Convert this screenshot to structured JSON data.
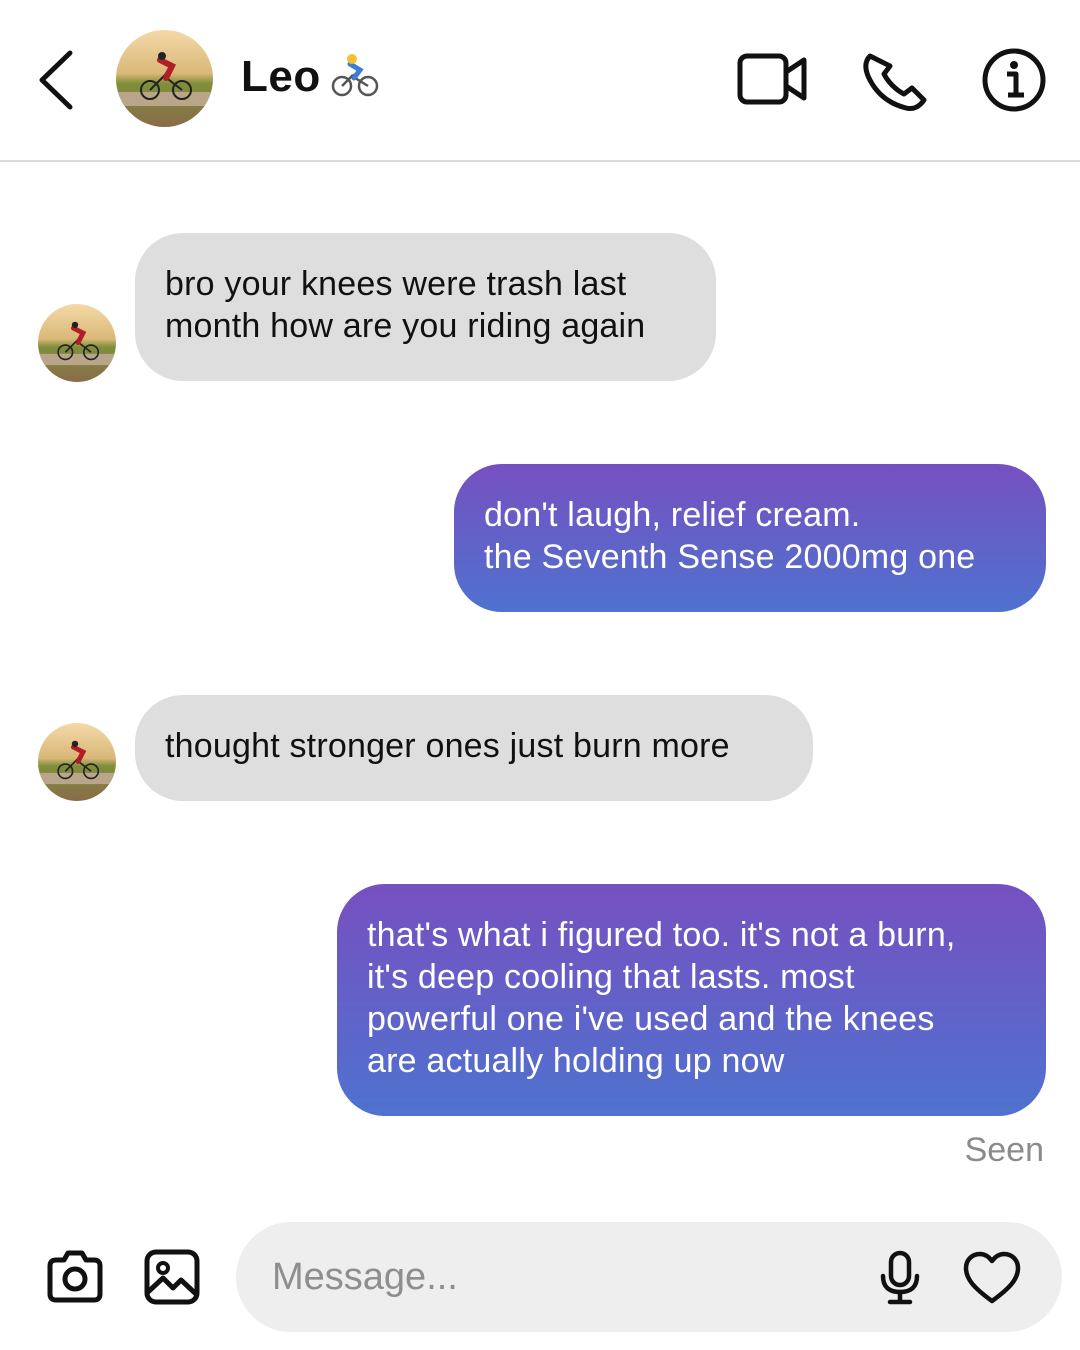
{
  "header": {
    "contact_name": "Leo",
    "icons": [
      "back-icon",
      "avatar",
      "cyclist-emoji-icon",
      "video-call-icon",
      "phone-call-icon",
      "info-icon"
    ]
  },
  "messages": [
    {
      "direction": "incoming",
      "lines": [
        "bro your knees were trash last",
        "month how are you riding again"
      ]
    },
    {
      "direction": "outgoing",
      "lines": [
        "don't laugh, relief cream.",
        "the Seventh Sense 2000mg one"
      ]
    },
    {
      "direction": "incoming",
      "lines": [
        "thought stronger ones just burn more"
      ]
    },
    {
      "direction": "outgoing",
      "lines": [
        "that's what i figured too. it's not a burn,",
        "it's deep cooling that lasts. most",
        "powerful one i've used and the knees",
        "are actually holding up now"
      ]
    }
  ],
  "status": {
    "seen": "Seen"
  },
  "composer": {
    "placeholder": "Message...",
    "icons": [
      "camera-icon",
      "gallery-icon",
      "microphone-icon",
      "heart-icon"
    ]
  },
  "colors": {
    "incoming_bubble": "#dedede",
    "outgoing_gradient_top": "#7650c0",
    "outgoing_gradient_bottom": "#4f72cf",
    "seen_text": "#8b8b8b"
  }
}
